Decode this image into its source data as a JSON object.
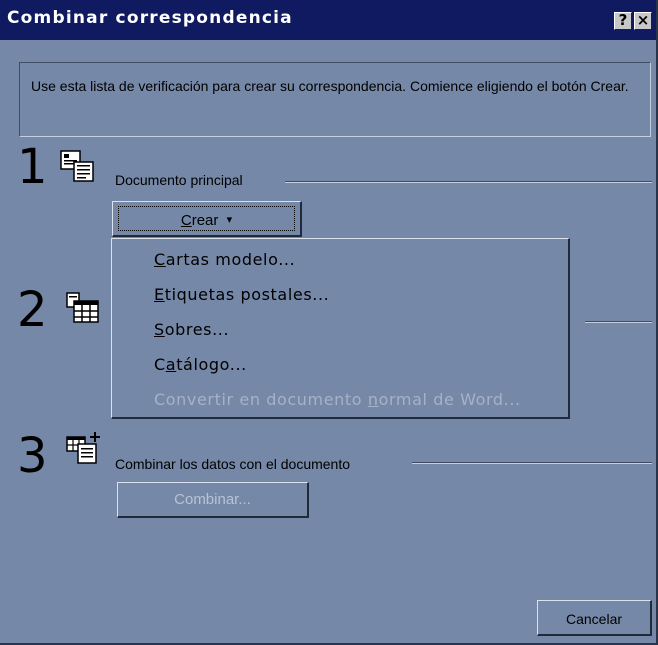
{
  "window": {
    "title": "Combinar correspondencia",
    "help_glyph": "?",
    "close_glyph": "×"
  },
  "intro": "Use esta lista de verificación para crear su correspondencia. Comience eligiendo el botón Crear.",
  "steps": [
    {
      "number": "1",
      "icon": "main-document-icon",
      "label": "Documento principal",
      "button": {
        "label": "Crear",
        "mnemonic": "C",
        "arrow": "▾"
      }
    },
    {
      "number": "2",
      "icon": "data-source-icon"
    },
    {
      "number": "3",
      "icon": "merge-data-icon",
      "label": "Combinar los datos con el documento",
      "button": {
        "label": "Combinar..."
      }
    }
  ],
  "create_menu": [
    {
      "label": "Cartas modelo...",
      "mnemonic": "C",
      "enabled": true
    },
    {
      "label": "Etiquetas postales...",
      "mnemonic": "E",
      "enabled": true
    },
    {
      "label": "Sobres...",
      "mnemonic": "S",
      "enabled": true
    },
    {
      "label": "Catálogo...",
      "mnemonic": "a",
      "enabled": true
    },
    {
      "label": "Convertir en documento normal de Word...",
      "mnemonic": "n",
      "enabled": false
    }
  ],
  "cancel_label": "Cancelar",
  "colors": {
    "dialog_bg": "#7588a7",
    "titlebar_bg": "#0f1a60",
    "title_text": "#ffffff",
    "disabled_text": "#b8c3d4"
  }
}
